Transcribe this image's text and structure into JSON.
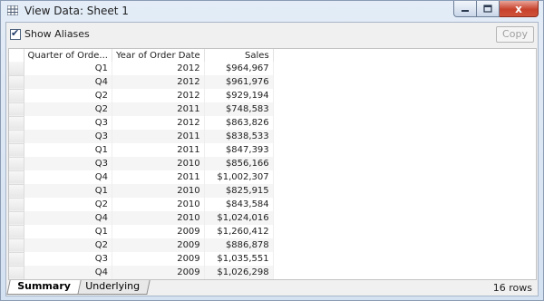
{
  "window": {
    "title": "View Data:  Sheet 1",
    "minimize_icon": "minimize-icon",
    "maximize_icon": "maximize-icon",
    "close_icon": "close-icon",
    "close_glyph": "x"
  },
  "toolbar": {
    "show_aliases_label": "Show Aliases",
    "show_aliases_checked": true,
    "copy_label": "Copy"
  },
  "table": {
    "columns": [
      "Quarter of Orde...",
      "Year of Order Date",
      "Sales"
    ],
    "rows": [
      [
        "Q1",
        "2012",
        "$964,967"
      ],
      [
        "Q4",
        "2012",
        "$961,976"
      ],
      [
        "Q2",
        "2012",
        "$929,194"
      ],
      [
        "Q2",
        "2011",
        "$748,583"
      ],
      [
        "Q3",
        "2012",
        "$863,826"
      ],
      [
        "Q3",
        "2011",
        "$838,533"
      ],
      [
        "Q1",
        "2011",
        "$847,393"
      ],
      [
        "Q3",
        "2010",
        "$856,166"
      ],
      [
        "Q4",
        "2011",
        "$1,002,307"
      ],
      [
        "Q1",
        "2010",
        "$825,915"
      ],
      [
        "Q2",
        "2010",
        "$843,584"
      ],
      [
        "Q4",
        "2010",
        "$1,024,016"
      ],
      [
        "Q1",
        "2009",
        "$1,260,412"
      ],
      [
        "Q2",
        "2009",
        "$886,878"
      ],
      [
        "Q3",
        "2009",
        "$1,035,551"
      ],
      [
        "Q4",
        "2009",
        "$1,026,298"
      ]
    ]
  },
  "tabs": [
    {
      "label": "Summary",
      "active": true
    },
    {
      "label": "Underlying",
      "active": false
    }
  ],
  "status": {
    "row_count": "16 rows"
  }
}
